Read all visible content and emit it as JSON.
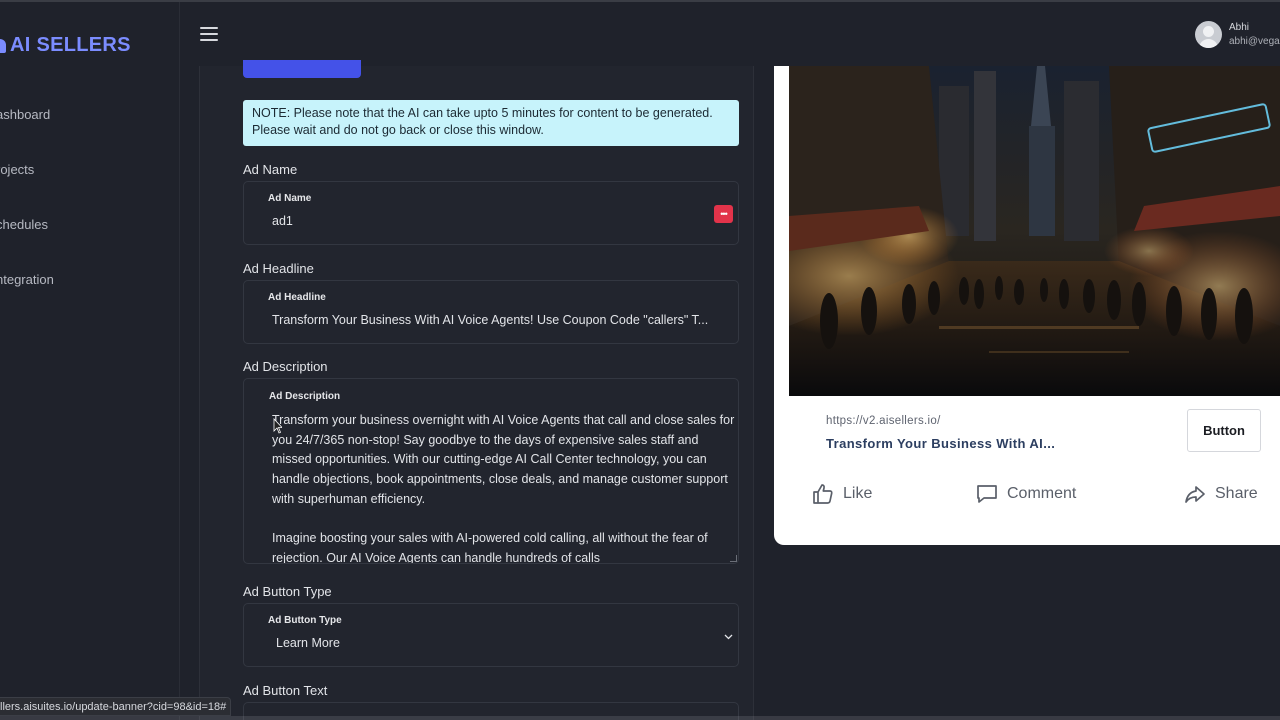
{
  "app": {
    "logo_text": "AI SELLERS"
  },
  "sidebar": {
    "items": [
      {
        "label": "ashboard"
      },
      {
        "label": "rojects"
      },
      {
        "label": "chedules"
      },
      {
        "label": "ntegration"
      }
    ]
  },
  "header": {
    "user_name": "Abhi",
    "user_email": "abhi@vega"
  },
  "form": {
    "note": "NOTE: Please note that the AI can take upto 5 minutes for content to be generated. Please wait and do not go back or close this window.",
    "ad_name": {
      "label": "Ad Name",
      "inner_label": "Ad Name",
      "value": "ad1"
    },
    "ad_headline": {
      "label": "Ad Headline",
      "inner_label": "Ad Headline",
      "value": "Transform Your Business With AI Voice Agents! Use Coupon Code \"callers\" T..."
    },
    "ad_description": {
      "label": "Ad Description",
      "inner_label": "Ad Description",
      "paragraph1": "Transform your business overnight with AI Voice Agents that call and close sales for you 24/7/365 non-stop! Say goodbye to the days of expensive sales staff and missed opportunities. With our cutting-edge AI Call Center technology, you can handle objections, book appointments, close deals, and manage customer support with superhuman efficiency.",
      "paragraph2": "Imagine boosting your sales with AI-powered cold calling, all without the fear of rejection. Our AI Voice Agents can handle hundreds of calls"
    },
    "ad_button_type": {
      "label": "Ad Button Type",
      "inner_label": "Ad Button Type",
      "value": "Learn More"
    },
    "ad_button_text": {
      "label": "Ad Button Text"
    }
  },
  "preview": {
    "url": "https://v2.aisellers.io/",
    "title": "Transform Your Business With AI...",
    "cta_label": "Button",
    "actions": {
      "like": "Like",
      "comment": "Comment",
      "share": "Share"
    }
  },
  "status_bar": {
    "url": "llers.aisuites.io/update-banner?cid=98&id=18#"
  },
  "colors": {
    "accent": "#4452e8",
    "logo": "#7b8cff",
    "note_bg": "#c7f3fb",
    "danger": "#e2334a"
  }
}
